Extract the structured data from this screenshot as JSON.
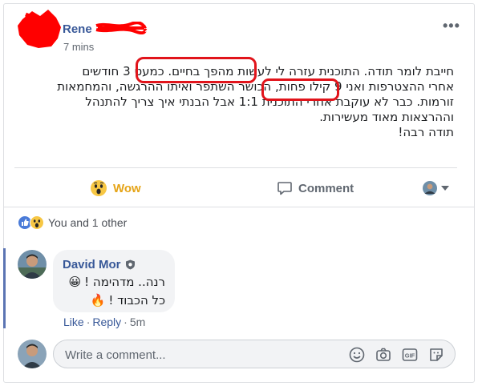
{
  "post": {
    "author_name": "Rene",
    "timestamp": "7 mins",
    "more_label": "•••",
    "text_lines": [
      "חייבת לומר תודה. התוכנית עזרה לי לעשות מהפך בחיים. כמעט 3 חודשים",
      "אחרי ההצטרפות ואני 9 קילו פחות, הכושר השתפר ואיתו ההרגשה, והמחמאות",
      "זורמות. כבר לא עוקבת אחרי התוכנית 1:1 אבל הבנתי איך צריך להתנהל",
      "וההרצאות מאוד מעשירות.",
      "תודה רבה!"
    ],
    "highlighted_phrases": [
      "לעשות מהפך בחיים",
      "9 קילו פחות"
    ],
    "highlight_color": "#e1141b"
  },
  "actions": {
    "wow_label": "Wow",
    "comment_label": "Comment"
  },
  "reactions": {
    "summary": "You and 1 other",
    "types": [
      "like-icon",
      "wow-icon"
    ]
  },
  "comment": {
    "author": "David Mor",
    "lines": [
      "רנה.. מדהימה !",
      "כל הכבוד !"
    ],
    "line_emojis": [
      "😀",
      "🔥"
    ],
    "like_label": "Like",
    "reply_label": "Reply",
    "time": "5m"
  },
  "composer": {
    "placeholder": "Write a comment...",
    "icons": [
      "emoji-icon",
      "camera-icon",
      "gif-icon",
      "sticker-icon"
    ]
  },
  "colors": {
    "link_blue": "#385898",
    "wow_yellow": "#e5a417",
    "secondary_text": "#606770",
    "border": "#dddfe2",
    "redaction_red": "#ff0000"
  }
}
